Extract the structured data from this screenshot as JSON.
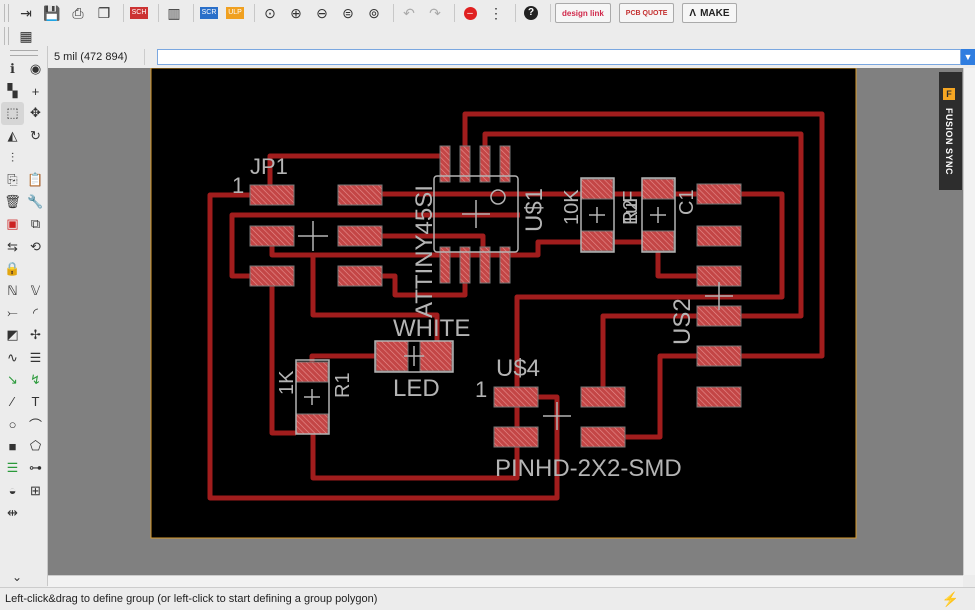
{
  "toolbar": {
    "icons": [
      {
        "name": "open-icon",
        "glyph": "⇥"
      },
      {
        "name": "save-icon",
        "glyph": "💾"
      },
      {
        "name": "print-icon",
        "glyph": "⎙"
      },
      {
        "name": "cam-icon",
        "glyph": "❐"
      },
      {
        "name": "sch-brd-switch-icon",
        "glyph": "SCH BRD"
      },
      {
        "name": "library-icon",
        "glyph": "▥"
      },
      {
        "name": "script-icon",
        "glyph": "SCR"
      },
      {
        "name": "ulp-icon",
        "glyph": "ULP"
      },
      {
        "name": "zoom-fit-icon",
        "glyph": "⊙"
      },
      {
        "name": "zoom-in-icon",
        "glyph": "⊕"
      },
      {
        "name": "zoom-out-icon",
        "glyph": "⊖"
      },
      {
        "name": "zoom-redraw-icon",
        "glyph": "⊜"
      },
      {
        "name": "zoom-select-icon",
        "glyph": "⊚"
      },
      {
        "name": "undo-icon",
        "glyph": "↶"
      },
      {
        "name": "redo-icon",
        "glyph": "↷"
      },
      {
        "name": "stop-icon",
        "glyph": "⛔"
      },
      {
        "name": "go-icon",
        "glyph": "⋮"
      },
      {
        "name": "help-icon",
        "glyph": "?"
      }
    ],
    "designlink_label": "design link",
    "pcb_quote_label": "PCB QUOTE",
    "make_label": "MAKE",
    "grid_icon": "grid-icon"
  },
  "command": {
    "coordinate": "5 mil (472 894)",
    "value": ""
  },
  "left_tools": [
    {
      "name": "info-icon",
      "glyph": "ℹ"
    },
    {
      "name": "show-icon",
      "glyph": "◉"
    },
    {
      "name": "layers-icon",
      "glyph": "▚"
    },
    {
      "name": "mark-icon",
      "glyph": "+"
    },
    {
      "name": "group-icon",
      "glyph": "⬚"
    },
    {
      "name": "move-icon",
      "glyph": "✥"
    },
    {
      "name": "mirror-icon",
      "glyph": "◭"
    },
    {
      "name": "rotate-icon",
      "glyph": "↻"
    },
    {
      "name": "align-icon",
      "glyph": "⫶"
    },
    {
      "name": "blank-icon",
      "glyph": ""
    },
    {
      "name": "copy-icon",
      "glyph": "⎘"
    },
    {
      "name": "paste-icon",
      "glyph": "📋"
    },
    {
      "name": "delete-icon",
      "glyph": "🗑"
    },
    {
      "name": "wrench-icon",
      "glyph": "🔧"
    },
    {
      "name": "add-icon",
      "glyph": "▣"
    },
    {
      "name": "replace-icon",
      "glyph": "⧉"
    },
    {
      "name": "swap-icon",
      "glyph": "⇆"
    },
    {
      "name": "lock-rotate-icon",
      "glyph": "⟲"
    },
    {
      "name": "lock-icon",
      "glyph": "🔒"
    },
    {
      "name": "blank2-icon",
      "glyph": ""
    },
    {
      "name": "name-icon",
      "glyph": "ℕ"
    },
    {
      "name": "value-icon",
      "glyph": "𝕍"
    },
    {
      "name": "split-icon",
      "glyph": "⤚"
    },
    {
      "name": "miter-icon",
      "glyph": "◜"
    },
    {
      "name": "optimize-icon",
      "glyph": "◩"
    },
    {
      "name": "ripup-icon",
      "glyph": "✢"
    },
    {
      "name": "meander-icon",
      "glyph": "∿"
    },
    {
      "name": "bus-icon",
      "glyph": "☰"
    },
    {
      "name": "route-icon",
      "glyph": "↘"
    },
    {
      "name": "autoroute-icon",
      "glyph": "↯"
    },
    {
      "name": "wire-icon",
      "glyph": "⁄"
    },
    {
      "name": "text-icon",
      "glyph": "T"
    },
    {
      "name": "circle-icon",
      "glyph": "○"
    },
    {
      "name": "arc-icon",
      "glyph": "⌒"
    },
    {
      "name": "rect-icon",
      "glyph": "■"
    },
    {
      "name": "polygon-icon",
      "glyph": "⬠"
    },
    {
      "name": "via-icon",
      "glyph": "☰"
    },
    {
      "name": "signal-icon",
      "glyph": "⊶"
    },
    {
      "name": "hole-icon",
      "glyph": "◒"
    },
    {
      "name": "attribute-icon",
      "glyph": "⊞"
    },
    {
      "name": "dimension-icon",
      "glyph": "⇹"
    },
    {
      "name": "blank3-icon",
      "glyph": ""
    }
  ],
  "board": {
    "labels": {
      "jp1": "JP1",
      "jp1_pin": "1",
      "us1_value": "ATTINY45SI",
      "us1_name": "U$1",
      "r2_value": "10K",
      "r2_name": "R2",
      "c1_value": "1uF",
      "c1_name": "C1",
      "us2_name": "US2",
      "led_value": "WHITE",
      "led_name": "LED",
      "r1_value": "1K",
      "r1_name": "R1",
      "us4_name": "U$4",
      "us4_pin": "1",
      "us4_value": "PINHD-2X2-SMD"
    },
    "colors": {
      "trace": "#a11d1d",
      "pad": "#c34646",
      "silk": "#b4b4b4",
      "board": "#000000",
      "outline": "#d99a2b"
    }
  },
  "fusion_sync": {
    "label": "FUSION SYNC"
  },
  "status": {
    "message": "Left-click&drag to define group (or left-click to start defining a group polygon)"
  }
}
